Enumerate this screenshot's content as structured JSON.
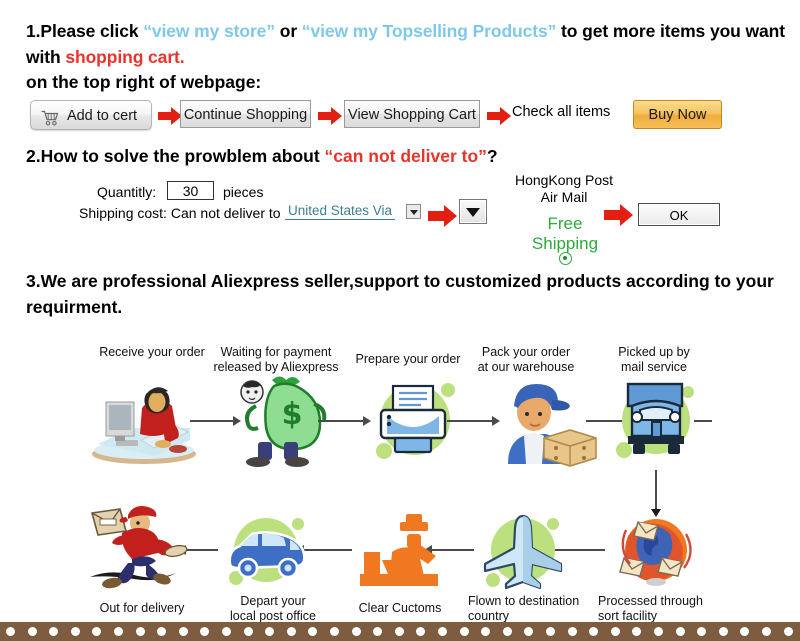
{
  "section1": {
    "number": "1.",
    "lead": "Please click ",
    "link_store": "“view my store”",
    "mid": " or ",
    "link_top": "“view my Topselling Products”",
    "tail": " to get more items you want with ",
    "highlight": "shopping cart",
    "period": ".",
    "subtitle": "on the top right of webpage:",
    "buttons": {
      "add_to_cart": "Add to cert",
      "continue_shopping": "Continue Shopping",
      "view_shopping_cart": "View Shopping Cart",
      "check_all_items": "Check all items",
      "buy_now": "Buy Now"
    }
  },
  "section2": {
    "number": "2.",
    "title_a": "How to solve the prowblem about ",
    "title_highlight": "“can not deliver to”",
    "title_b": "?",
    "quantity_label": "Quantitly:",
    "quantity_value": "30",
    "quantity_unit": "pieces",
    "shipping_label": "Shipping cost: Can not deliver to",
    "country_value": "United States Via",
    "carrier_line1": "HongKong Post",
    "carrier_line2": "Air Mail",
    "free_line1": "Free",
    "free_line2": "Shipping",
    "ok_label": "OK"
  },
  "section3": {
    "number": "3.",
    "text": "We are professional Aliexpress seller,support to customized products according to your requirment."
  },
  "flow": {
    "top": [
      {
        "id": "receive-order",
        "label_lines": [
          "Receive your order"
        ],
        "icon": "person-at-computer-icon"
      },
      {
        "id": "waiting-payment",
        "label_lines": [
          "Waiting for payment",
          "released by Aliexpress"
        ],
        "icon": "money-bag-icon"
      },
      {
        "id": "prepare-order",
        "label_lines": [
          "Prepare your order"
        ],
        "icon": "printer-icon"
      },
      {
        "id": "pack-order",
        "label_lines": [
          "Pack your order",
          "at our warehouse"
        ],
        "icon": "warehouse-worker-icon"
      },
      {
        "id": "picked-up",
        "label_lines": [
          "Picked up by",
          "mail service"
        ],
        "icon": "mail-truck-icon"
      }
    ],
    "bottom": [
      {
        "id": "out-for-delivery",
        "label_lines": [
          "Out for delivery"
        ],
        "icon": "running-courier-icon"
      },
      {
        "id": "depart-post-office",
        "label_lines": [
          "Depart your",
          "local post office"
        ],
        "icon": "delivery-van-icon"
      },
      {
        "id": "clear-customs",
        "label_lines": [
          "Clear Cuctoms"
        ],
        "icon": "customs-officer-icon"
      },
      {
        "id": "flown-destination",
        "label_lines": [
          "Flown to destination",
          "country"
        ],
        "icon": "airplane-icon"
      },
      {
        "id": "sort-facility",
        "label_lines": [
          "Processed through",
          "sort facility"
        ],
        "icon": "global-mail-icon"
      }
    ]
  },
  "colors": {
    "link_blue": "#7ec8e8",
    "accent_red": "#e8342a",
    "arrow_red": "#e31f12",
    "green": "#2fa83a",
    "buy_now_gold": "#f0ad3c",
    "country_teal": "#3c7f8e",
    "bottom_bar_brown": "#7d5c3f",
    "blob_green": "#b8dc7a"
  }
}
